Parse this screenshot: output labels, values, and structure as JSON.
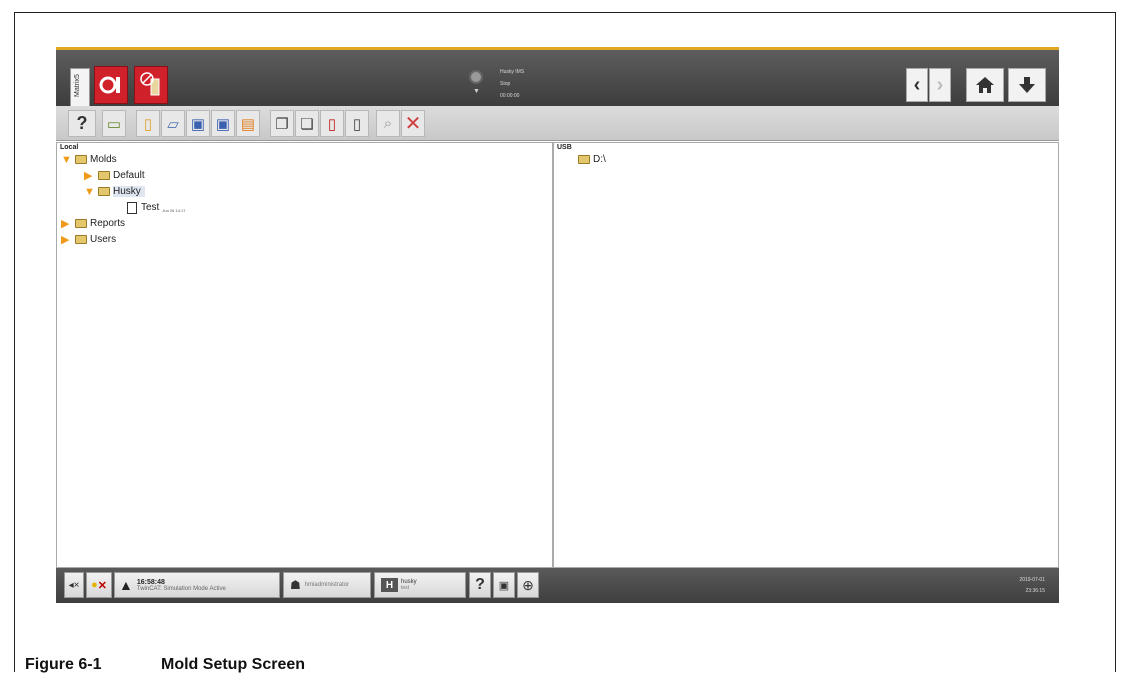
{
  "topbar": {
    "side_tab": "Matrix5",
    "status_lines": [
      "Husky IMS",
      "Stop",
      "00:00:00"
    ]
  },
  "toolbar": {
    "help_label": "?"
  },
  "left_pane": {
    "title": "Local",
    "tree": [
      {
        "label": "Molds",
        "expanded": true,
        "level": 0
      },
      {
        "label": "Default",
        "expanded": false,
        "level": 1
      },
      {
        "label": "Husky",
        "expanded": true,
        "level": 1,
        "selected": true
      },
      {
        "label": "Test",
        "level": 2,
        "file": true,
        "timestamp": "Jun 26 14:17"
      },
      {
        "label": "Reports",
        "expanded": false,
        "level": 0
      },
      {
        "label": "Users",
        "expanded": false,
        "level": 0
      }
    ]
  },
  "right_pane": {
    "title": "USB",
    "tree": [
      {
        "label": "D:\\"
      }
    ]
  },
  "bottombar": {
    "alarm_time": "16:58:48",
    "alarm_message": "TwinCAT: Simulation Mode Active",
    "user": "hmiadministrator",
    "mold_name": "husky",
    "mold_sub": "test",
    "help_label": "?",
    "date": "2019-07-01",
    "time": "23:36:15"
  },
  "caption": {
    "figure": "Figure 6-1",
    "title": "Mold Setup Screen"
  },
  "colors": {
    "accent": "#e1a720",
    "app_red": "#d0202a",
    "folder": "#e3c76a",
    "expander": "#f09a1a"
  }
}
